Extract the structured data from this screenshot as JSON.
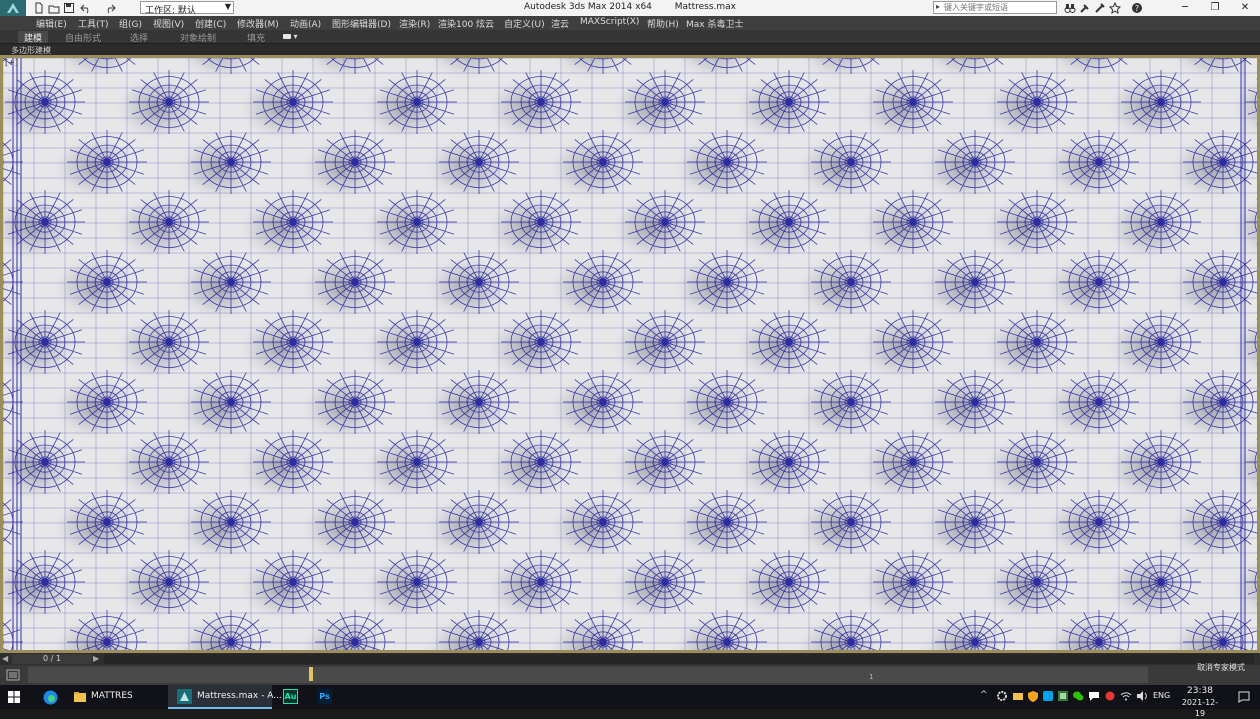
{
  "title_bar": {
    "workspace": "工作区: 默认",
    "app_title": "Autodesk 3ds Max  2014 x64",
    "file_name": "Mattress.max",
    "search_placeholder": "键入关键字或短语",
    "icons": [
      "new-icon",
      "open-icon",
      "save-icon",
      "undo-icon",
      "redo-icon",
      "search-icon",
      "binoculars-icon",
      "favorites-icon",
      "star-icon",
      "help-icon"
    ]
  },
  "menu": {
    "items": [
      "编辑(E)",
      "工具(T)",
      "组(G)",
      "视图(V)",
      "创建(C)",
      "修改器(M)",
      "动画(A)",
      "图形编辑器(D)",
      "渲染(R)",
      "渲染100",
      "炫云",
      "自定义(U)",
      "渲云",
      "MAXScript(X)",
      "帮助(H)",
      "Max 杀毒卫士"
    ]
  },
  "ribbon": {
    "tabs": [
      "建模",
      "自由形式",
      "选择",
      "对象绘制",
      "填充"
    ],
    "active_tab": "建模",
    "panel_label": "多边形建模"
  },
  "viewport": {
    "label": "[+]",
    "background": "#e7e7ea",
    "wire_color": "#1e1e9a"
  },
  "timeline": {
    "frame_display": "0 / 1",
    "marker": "1",
    "status": "取消专家模式"
  },
  "taskbar": {
    "items": [
      {
        "label": "MATTRES",
        "icon": "folder-icon"
      },
      {
        "label": "Mattress.max - A...",
        "icon": "3dsmax-icon"
      },
      {
        "label": "",
        "icon": "audition-icon",
        "glyph": "Au"
      },
      {
        "label": "",
        "icon": "photoshop-icon",
        "glyph": "Ps"
      }
    ],
    "language": "ENG",
    "time": "23:38",
    "date": "2021-12-19"
  }
}
